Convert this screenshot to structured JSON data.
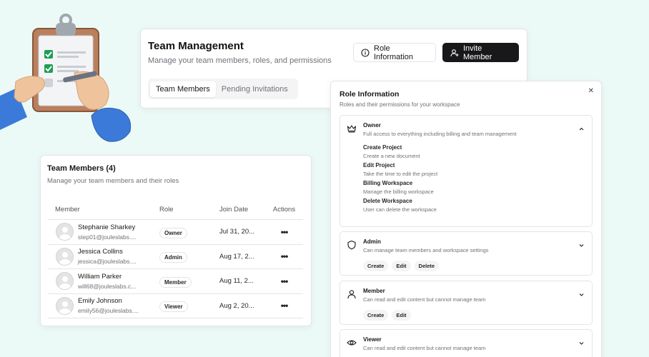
{
  "header": {
    "title": "Team Management",
    "subtitle": "Manage your team members, roles, and permissions",
    "role_info_label": "Role Information",
    "invite_label": "Invite Member",
    "tabs": [
      {
        "label": "Team Members",
        "active": true
      },
      {
        "label": "Pending Invitations",
        "active": false
      }
    ]
  },
  "members": {
    "title": "Team Members (4)",
    "subtitle": "Manage your team members and their roles",
    "columns": [
      "Member",
      "Role",
      "Join Date",
      "Actions"
    ],
    "rows": [
      {
        "name": "Stephanie Sharkey",
        "email": "step01@jouleslabs....",
        "role": "Owner",
        "date": "Jul 31, 20...",
        "actions": "•••"
      },
      {
        "name": "Jessica Collins",
        "email": "jessica@jouleslabs....",
        "role": "Admin",
        "date": "Aug 17, 2...",
        "actions": "•••"
      },
      {
        "name": "William Parker",
        "email": "will68@jouleslabs.c...",
        "role": "Member",
        "date": "Aug 11, 2...",
        "actions": "•••"
      },
      {
        "name": "Emily Johnson",
        "email": "emily56@jouleslabs....",
        "role": "Viewer",
        "date": "Aug 2, 20...",
        "actions": "•••"
      }
    ]
  },
  "role_panel": {
    "title": "Role Information",
    "subtitle": "Roles and their permissions for your workspace",
    "close": "✕",
    "roles": [
      {
        "name": "Owner",
        "description": "Full access to everything including billing and team management",
        "icon": "crown-icon",
        "expanded": true,
        "permissions": [
          {
            "name": "Create Project",
            "description": "Create a new document"
          },
          {
            "name": "Edit Project",
            "description": "Take the time to edit the project"
          },
          {
            "name": "Billing Workspace",
            "description": "Manage the billing workspace"
          },
          {
            "name": "Delete Workspace",
            "description": "User can delete the workspace"
          }
        ]
      },
      {
        "name": "Admin",
        "description": "Can manage team members and workspace settings",
        "icon": "shield-icon",
        "expanded": false,
        "chips": [
          "Create",
          "Edit",
          "Delete"
        ]
      },
      {
        "name": "Member",
        "description": "Can read and edit content but cannot manage team",
        "icon": "user-icon",
        "expanded": false,
        "chips": [
          "Create",
          "Edit"
        ]
      },
      {
        "name": "Viewer",
        "description": "Can read and edit content but cannot manage team",
        "icon": "eye-icon",
        "expanded": false,
        "chips": []
      }
    ]
  },
  "colors": {
    "background": "#ecfaf7",
    "primary_button": "#18181b",
    "muted_text": "#71717a",
    "border": "#e4e4e7"
  }
}
